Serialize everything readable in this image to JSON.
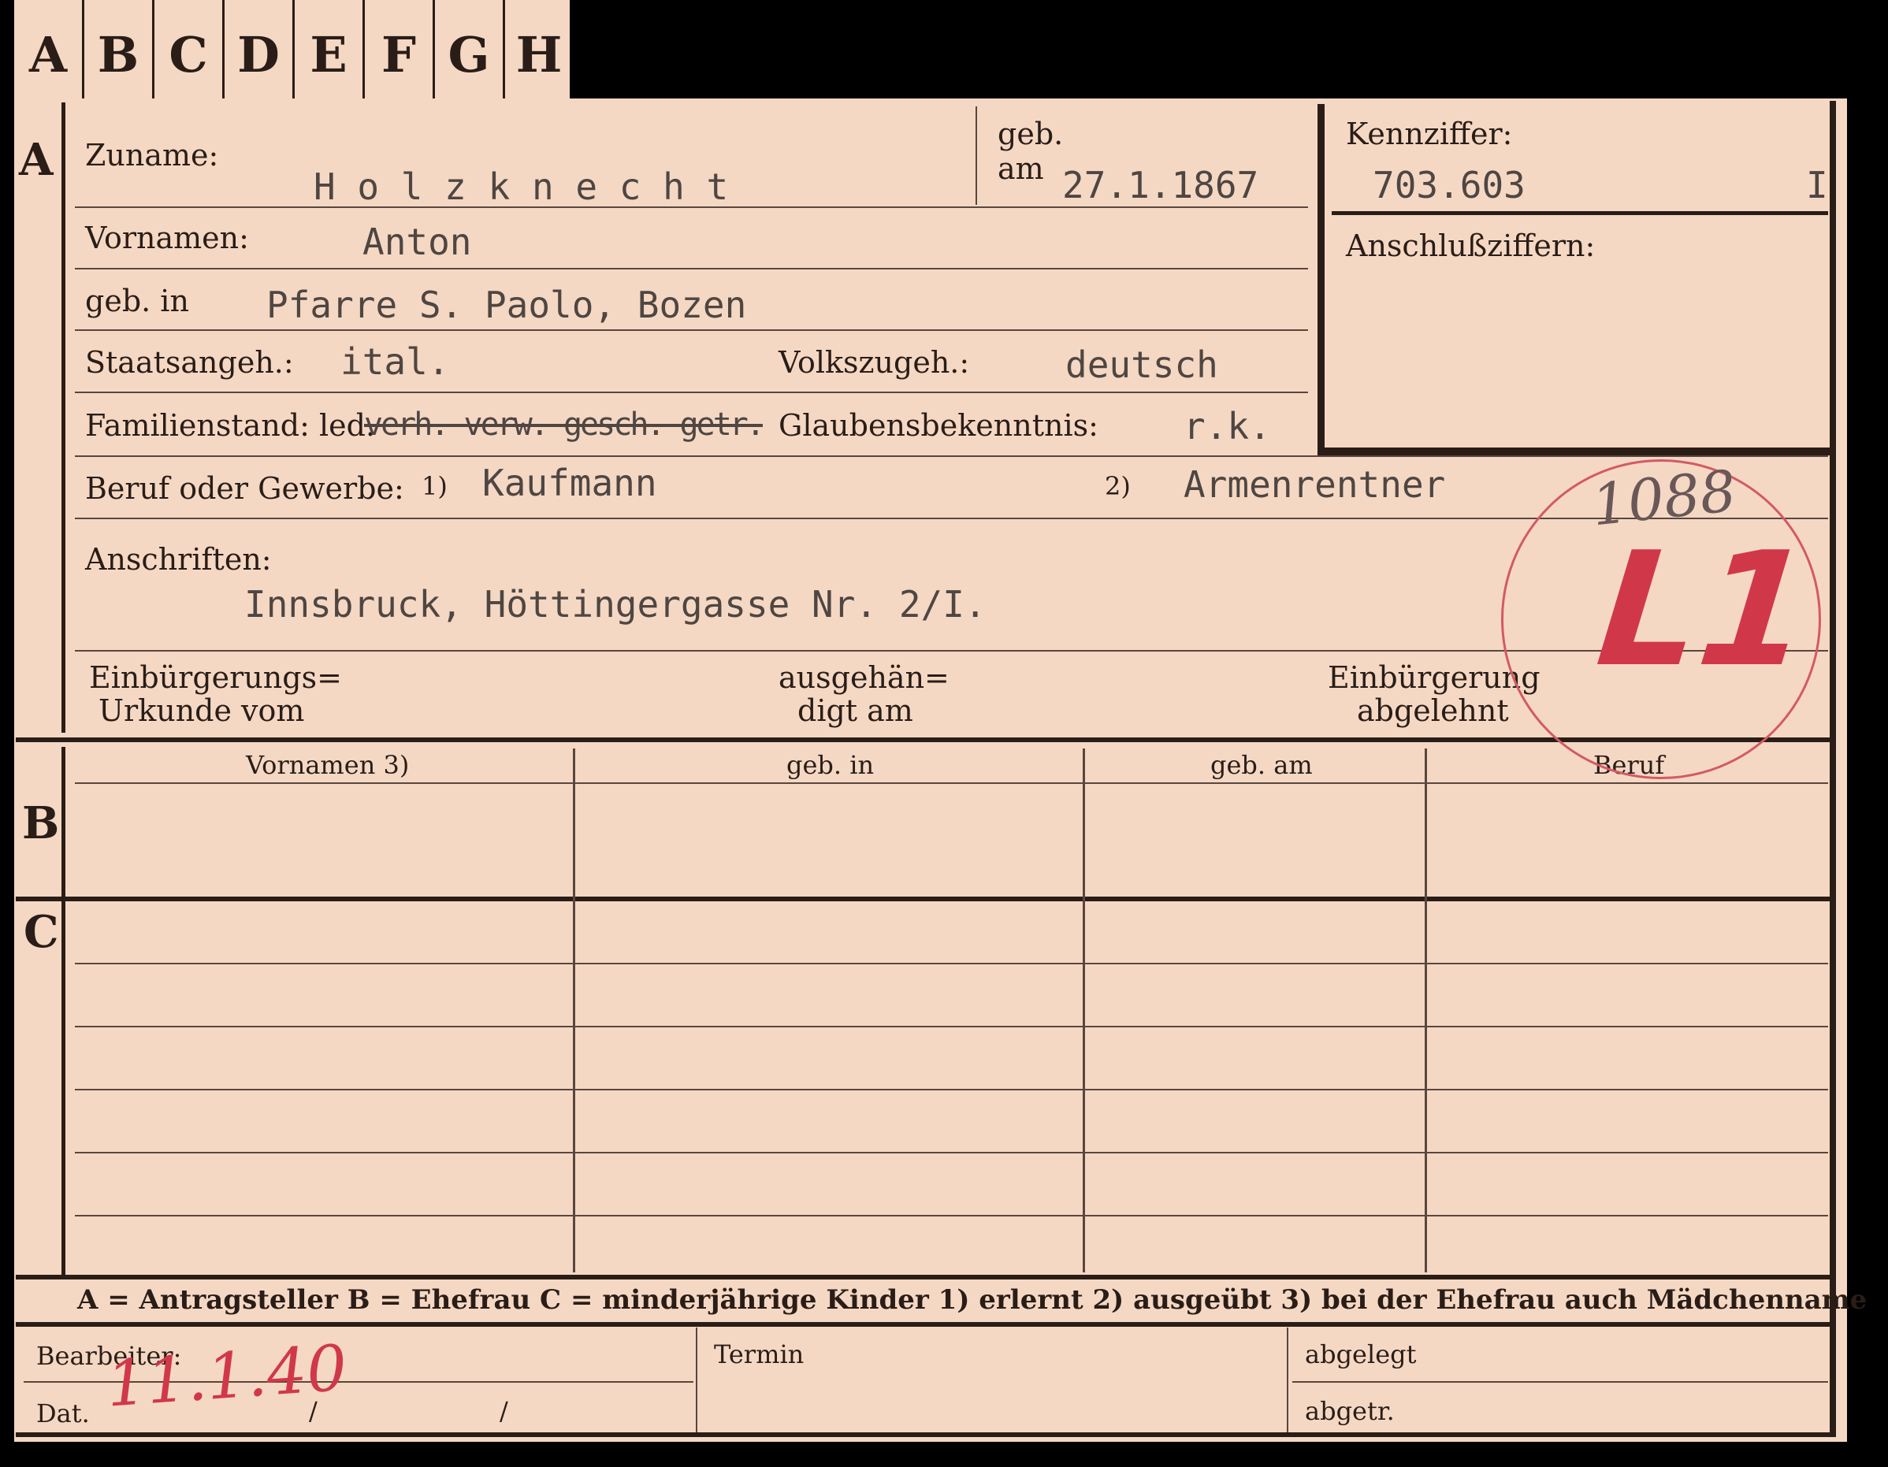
{
  "tabs": [
    "A",
    "B",
    "C",
    "D",
    "E",
    "F",
    "G",
    "H"
  ],
  "sections": {
    "a": "A",
    "b": "B",
    "c": "C"
  },
  "labels": {
    "zuname": "Zuname:",
    "geb": "geb.",
    "am": "am",
    "kennziffer": "Kennziffer:",
    "anschluss": "Anschlußziffern:",
    "vornamen": "Vornamen:",
    "geb_in": "geb. in",
    "staatsangeh": "Staatsangeh.:",
    "volkszugeh": "Volkszugeh.:",
    "familienstand": "Familienstand: led.",
    "glaube": "Glaubensbekenntnis:",
    "beruf": "Beruf oder Gewerbe:",
    "fn1": "1)",
    "fn2": "2)",
    "anschriften": "Anschriften:",
    "einb1": "Einbürgerungs=",
    "einb2": "Urkunde vom",
    "ausg1": "ausgehän=",
    "ausg2": "digt am",
    "abg1": "Einbürgerung",
    "abg2": "abgelehnt",
    "col_vornamen": "Vornamen 3)",
    "col_gebin": "geb. in",
    "col_gebam": "geb. am",
    "col_beruf": "Beruf",
    "legend": "A = Antragsteller   B = Ehefrau   C = minderjährige Kinder   1) erlernt   2) ausgeübt   3) bei der Ehefrau auch Mädchenname",
    "bearbeiter": "Bearbeiter:",
    "termin": "Termin",
    "abgelegt": "abgelegt",
    "dat": "Dat.",
    "slash": "/",
    "abgetr": "abgetr."
  },
  "person": {
    "surname": "H o l z k n e c h t",
    "birthdate": "27.1.1867",
    "kennziffer": "703.603",
    "kennziffer_suffix": "I",
    "first_names": "Anton",
    "birthplace": "Pfarre S. Paolo, Bozen",
    "citizenship": "ital.",
    "ethnicity": "deutsch",
    "marital_struck": "verh. verw. gesch. getr.",
    "religion": "r.k.",
    "occupation_learned": "Kaufmann",
    "occupation_practiced": "Armenrentner",
    "address": "Innsbruck, Höttingergasse Nr. 2/I."
  },
  "stamp": {
    "code": "L1",
    "number": "1088"
  },
  "handwritten_date": "11.1.40"
}
